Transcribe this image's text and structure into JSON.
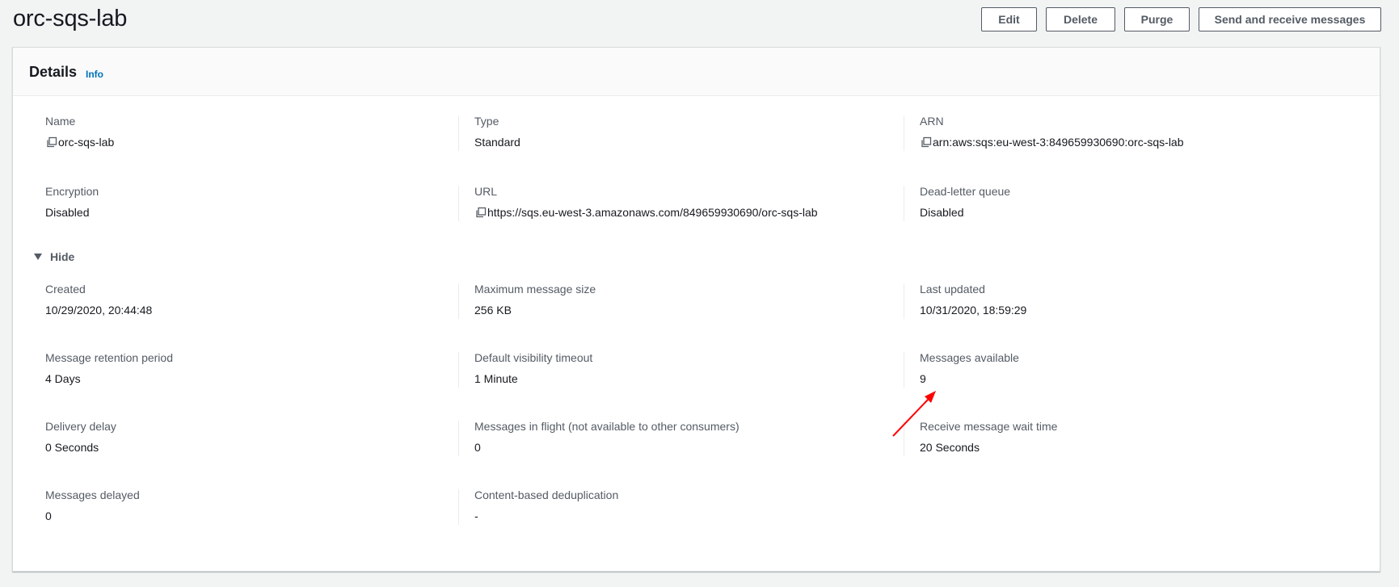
{
  "header": {
    "title": "orc-sqs-lab",
    "buttons": {
      "edit": "Edit",
      "delete": "Delete",
      "purge": "Purge",
      "send": "Send and receive messages"
    }
  },
  "details": {
    "title": "Details",
    "info": "Info",
    "toggle_label": "Hide",
    "fields": {
      "name": {
        "label": "Name",
        "value": "orc-sqs-lab"
      },
      "type": {
        "label": "Type",
        "value": "Standard"
      },
      "arn": {
        "label": "ARN",
        "value": "arn:aws:sqs:eu-west-3:849659930690:orc-sqs-lab"
      },
      "encryption": {
        "label": "Encryption",
        "value": "Disabled"
      },
      "url": {
        "label": "URL",
        "value": "https://sqs.eu-west-3.amazonaws.com/849659930690/orc-sqs-lab"
      },
      "dlq": {
        "label": "Dead-letter queue",
        "value": "Disabled"
      },
      "created": {
        "label": "Created",
        "value": "10/29/2020, 20:44:48"
      },
      "max_size": {
        "label": "Maximum message size",
        "value": "256 KB"
      },
      "last_updated": {
        "label": "Last updated",
        "value": "10/31/2020, 18:59:29"
      },
      "retention": {
        "label": "Message retention period",
        "value": "4 Days"
      },
      "visibility": {
        "label": "Default visibility timeout",
        "value": "1 Minute"
      },
      "available": {
        "label": "Messages available",
        "value": "9"
      },
      "delivery_delay": {
        "label": "Delivery delay",
        "value": "0 Seconds"
      },
      "in_flight": {
        "label": "Messages in flight (not available to other consumers)",
        "value": "0"
      },
      "wait_time": {
        "label": "Receive message wait time",
        "value": "20 Seconds"
      },
      "delayed": {
        "label": "Messages delayed",
        "value": "0"
      },
      "dedup": {
        "label": "Content-based deduplication",
        "value": "-"
      }
    }
  },
  "colors": {
    "link": "#0073bb",
    "annotation_arrow": "#ff0000"
  },
  "icons": [
    "copy-icon",
    "caret-down-icon",
    "annotation-arrow"
  ]
}
